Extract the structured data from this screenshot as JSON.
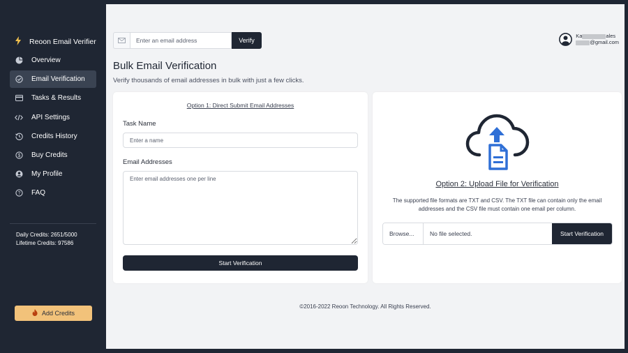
{
  "sidebar": {
    "brand": "Reoon Email Verifier",
    "items": [
      {
        "label": "Overview",
        "icon": "pie-chart-icon"
      },
      {
        "label": "Email Verification",
        "icon": "check-circle-icon",
        "active": true
      },
      {
        "label": "Tasks & Results",
        "icon": "card-icon"
      },
      {
        "label": "API Settings",
        "icon": "code-icon"
      },
      {
        "label": "Credits History",
        "icon": "history-icon"
      },
      {
        "label": "Buy Credits",
        "icon": "dollar-icon"
      },
      {
        "label": "My Profile",
        "icon": "user-circle-icon"
      },
      {
        "label": "FAQ",
        "icon": "question-circle-icon"
      }
    ],
    "daily_credits": "Daily Credits: 2651/5000",
    "lifetime_credits": "Lifetime Credits: 97586",
    "add_credits_label": "Add Credits"
  },
  "header": {
    "search_placeholder": "Enter an email address",
    "verify_label": "Verify",
    "user_name_start": "Ka",
    "user_name_end": "ales",
    "user_email_end": "@gmail.com"
  },
  "main": {
    "title": "Bulk Email Verification",
    "subtitle": "Verify thousands of email addresses in bulk with just a few clicks.",
    "option1": {
      "link": "Option 1: Direct Submit Email Addresses",
      "task_name_label": "Task Name",
      "task_name_placeholder": "Enter a name",
      "emails_label": "Email Addresses",
      "emails_placeholder": "Enter email addresses one per line",
      "start_label": "Start Verification"
    },
    "option2": {
      "link": "Option 2: Upload File for Verification",
      "description": "The supported file formats are TXT and CSV. The TXT file can contain only the email addresses and the CSV file must contain one email per column.",
      "browse_label": "Browse...",
      "file_status": "No file selected.",
      "start_label": "Start Verification"
    }
  },
  "footer": "©2016-2022 Reoon Technology. All Rights Reserved.",
  "colors": {
    "sidebar_bg": "#1f2633",
    "accent_yellow": "#f2c27a",
    "upload_blue": "#2f6fd6",
    "dark_button": "#1f2633"
  }
}
